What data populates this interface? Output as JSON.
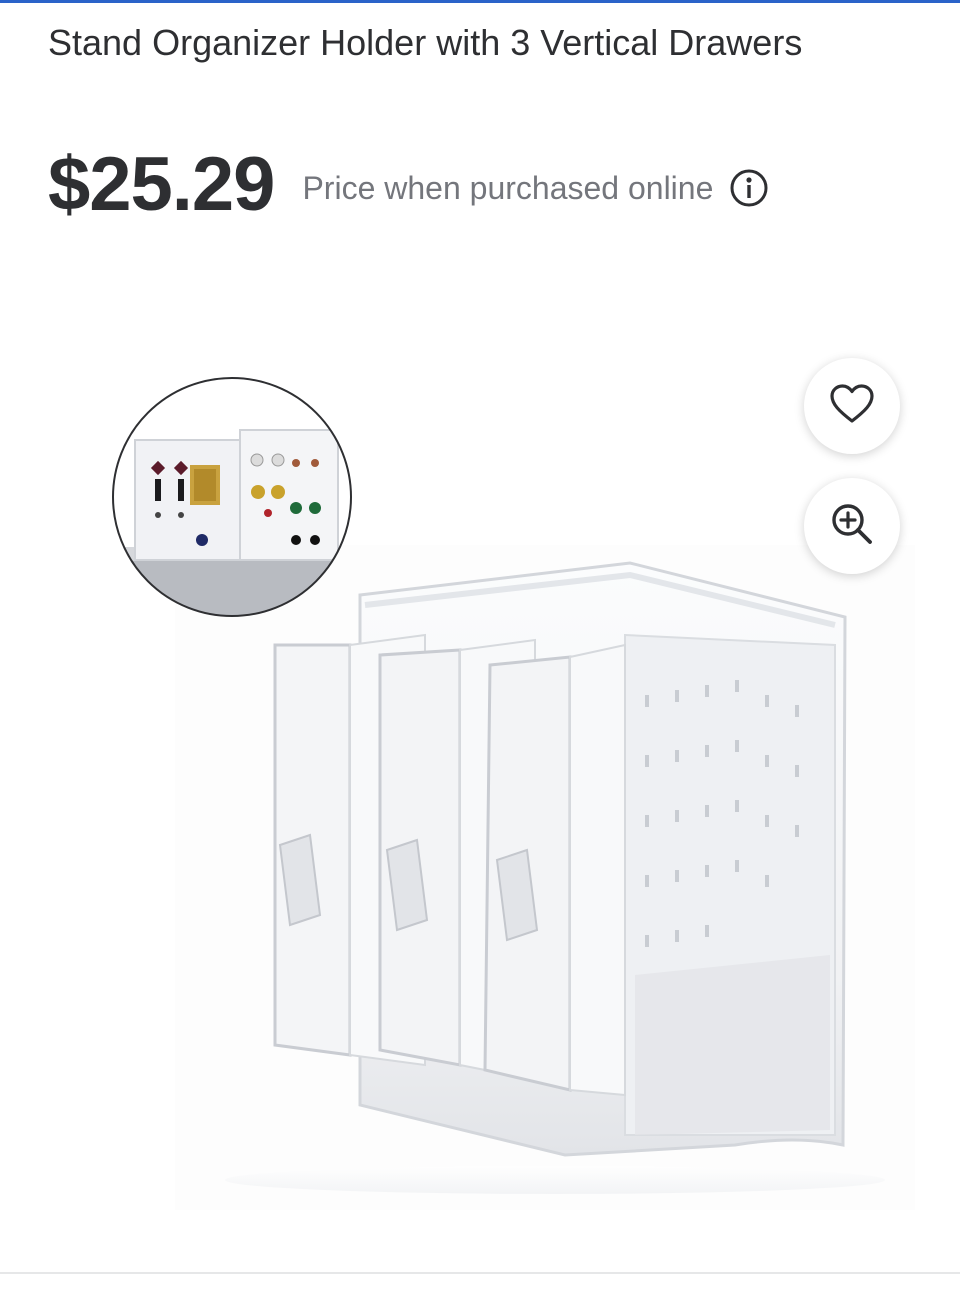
{
  "product": {
    "title": "Stand Organizer Holder with 3 Vertical Drawers",
    "price": "$25.29",
    "price_note": "Price when purchased online"
  },
  "icons": {
    "info": "info-circle-icon",
    "favorite": "heart-outline-icon",
    "zoom": "zoom-in-icon"
  },
  "colors": {
    "accent": "#2a63c9",
    "text": "#2e2f32",
    "muted": "#74767c"
  }
}
